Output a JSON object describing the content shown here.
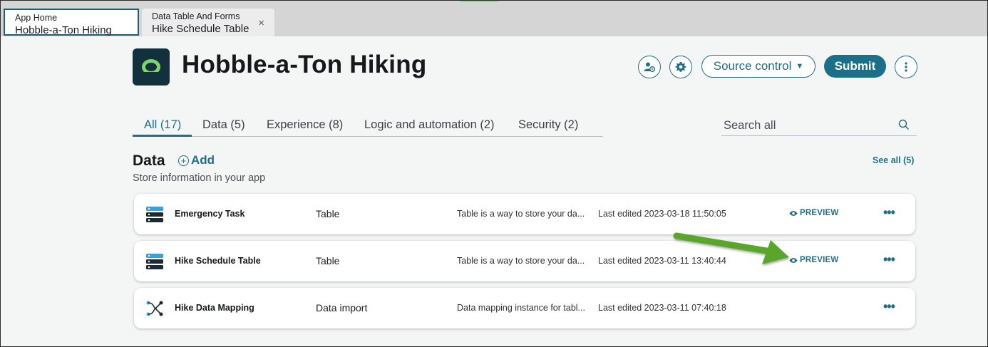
{
  "tabs": [
    {
      "title": "App Home",
      "subtitle": "Hobble-a-Ton Hiking",
      "active": true
    },
    {
      "title": "Data Table And Forms",
      "subtitle": "Hike Schedule Table",
      "active": false,
      "close": "×"
    }
  ],
  "header": {
    "app_title": "Hobble-a-Ton Hiking",
    "source_control_label": "Source control",
    "submit_label": "Submit",
    "icons": [
      "user-settings-icon",
      "gear-icon",
      "kebab-menu-icon"
    ]
  },
  "filters": {
    "tabs": [
      "All (17)",
      "Data (5)",
      "Experience (8)",
      "Logic and automation (2)",
      "Security (2)"
    ],
    "active_index": 0
  },
  "search": {
    "placeholder": "Search all"
  },
  "section": {
    "title": "Data",
    "add_label": "Add",
    "subtitle": "Store information in your app",
    "see_all_label": "See all (5)"
  },
  "rows": [
    {
      "name": "Emergency Task",
      "type": "Table",
      "description": "Table is a way to store your da...",
      "edited": "Last edited 2023-03-18 11:50:05",
      "preview": "PREVIEW",
      "icon": "table-icon"
    },
    {
      "name": "Hike Schedule Table",
      "type": "Table",
      "description": "Table is a way to store your da...",
      "edited": "Last edited 2023-03-11 13:40:44",
      "preview": "PREVIEW",
      "icon": "table-icon"
    },
    {
      "name": "Hike Data Mapping",
      "type": "Data import",
      "description": "Data mapping instance for tabl...",
      "edited": "Last edited 2023-03-11 07:40:18",
      "preview": "",
      "icon": "data-mapping-icon"
    }
  ],
  "colors": {
    "accent": "#1f6f87",
    "logo_bg": "#13313d",
    "logo_ring": "#7fd46a",
    "annotation_arrow": "#5aa62a"
  }
}
